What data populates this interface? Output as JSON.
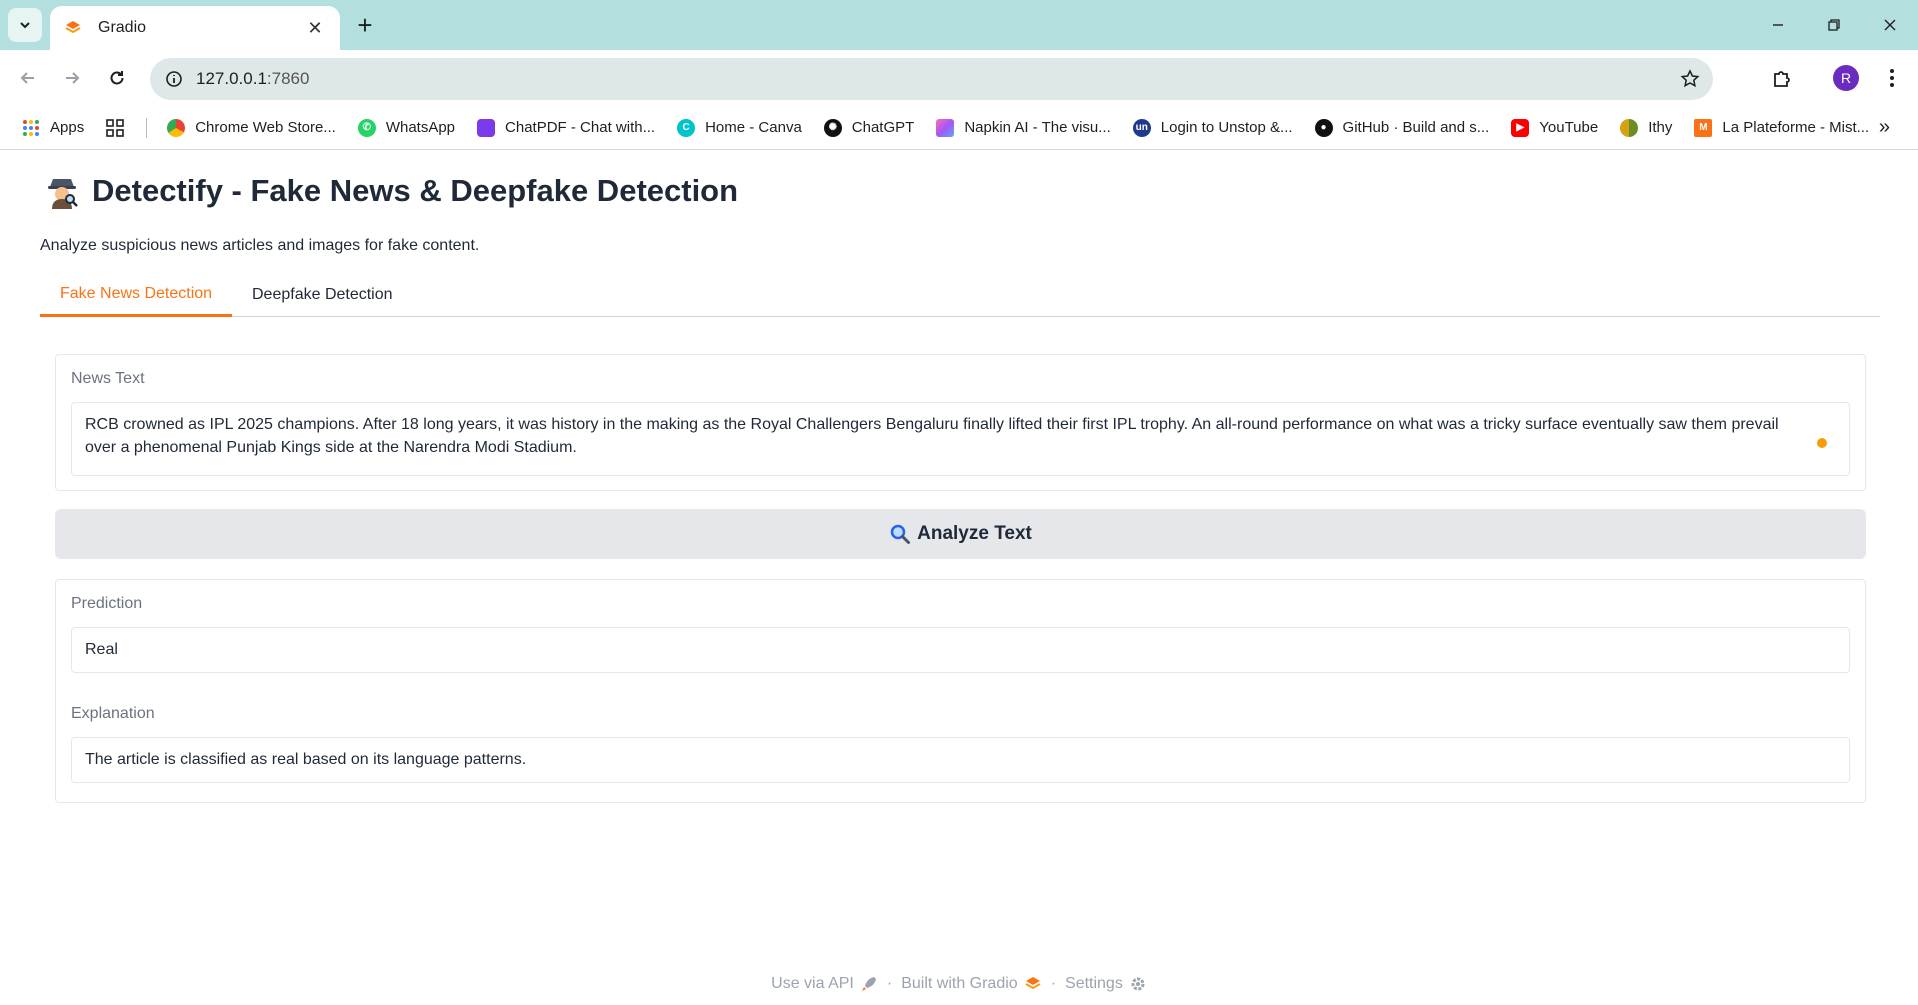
{
  "browser": {
    "tab_title": "Gradio",
    "url_host": "127.0.0.1",
    "url_port": ":7860",
    "profile_initial": "R",
    "bookmarks": [
      {
        "label": "Apps",
        "color": "#ea4335"
      },
      {
        "label": "Chrome Web Store...",
        "color": "#34a853"
      },
      {
        "label": "WhatsApp",
        "color": "#25d366"
      },
      {
        "label": "ChatPDF - Chat with...",
        "color": "#7c3aed"
      },
      {
        "label": "Home - Canva",
        "color": "#00c4cc"
      },
      {
        "label": "ChatGPT",
        "color": "#111111"
      },
      {
        "label": "Napkin AI - The visu...",
        "color": "#a855f7"
      },
      {
        "label": "Login to Unstop &...",
        "color": "#1e3a8a"
      },
      {
        "label": "GitHub · Build and s...",
        "color": "#111111"
      },
      {
        "label": "YouTube",
        "color": "#ff0000"
      },
      {
        "label": "Ithy",
        "color": "#d4a017"
      },
      {
        "label": "La Plateforme - Mist...",
        "color": "#f97316"
      }
    ]
  },
  "app": {
    "title": "Detectify - Fake News & Deepfake Detection",
    "description": "Analyze suspicious news articles and images for fake content.",
    "tabs": [
      {
        "label": "Fake News Detection",
        "active": true
      },
      {
        "label": "Deepfake Detection",
        "active": false
      }
    ],
    "news_text": {
      "label": "News Text",
      "value": "RCB crowned as IPL 2025 champions. After 18 long years, it was history in the making as the Royal Challengers Bengaluru finally lifted their first IPL trophy. An all-round performance on what was a tricky surface eventually saw them prevail over a phenomenal Punjab Kings side at the Narendra Modi Stadium."
    },
    "analyze_button": "Analyze Text",
    "prediction": {
      "label": "Prediction",
      "value": "Real"
    },
    "explanation": {
      "label": "Explanation",
      "value": "The article is classified as real based on its language patterns."
    }
  },
  "footer": {
    "api": "Use via API",
    "built": "Built with Gradio",
    "settings": "Settings",
    "dot": "·"
  },
  "colors": {
    "accent": "#f97316",
    "tabstrip": "#b3e0df"
  }
}
